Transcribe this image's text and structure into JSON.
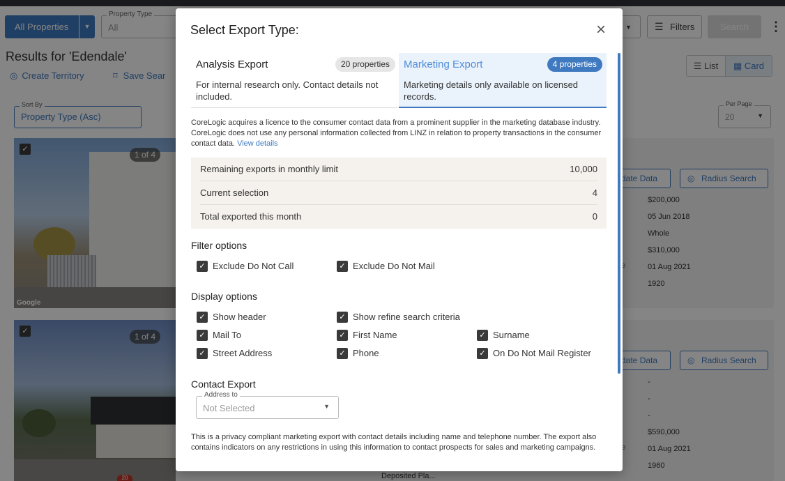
{
  "toolbar": {
    "all_properties": "All Properties",
    "property_type_label": "Property Type",
    "property_type_value": "All",
    "filters": "Filters",
    "search": "Search"
  },
  "results": {
    "title": "Results for 'Edendale'",
    "create_territory": "Create Territory",
    "save_search": "Save Sear",
    "view_list": "List",
    "view_card": "Card",
    "sort_by_label": "Sort By",
    "sort_by_value": "Property Type (Asc)",
    "per_page_label": "Per Page",
    "per_page_value": "20"
  },
  "cards": [
    {
      "counter": "1 of 4",
      "google": "Google",
      "update_label": "date Data",
      "radius_label": "Radius Search",
      "values": [
        "$200,000",
        "05 Jun 2018",
        "Whole",
        "$310,000",
        "01 Aug 2021",
        "1920"
      ],
      "stubs": [
        "e",
        "ate"
      ]
    },
    {
      "counter": "1 of 4",
      "update_label": "date Data",
      "radius_label": "Radius Search",
      "values": [
        "-",
        "-",
        "-",
        "$590,000",
        "01 Aug 2021",
        "1960"
      ],
      "stubs": [
        "e",
        "ate"
      ]
    }
  ],
  "deposited": "Deposited Pla...",
  "badge": "20",
  "modal": {
    "title": "Select Export Type:",
    "tabs": {
      "analysis": {
        "name": "Analysis Export",
        "pill": "20 properties",
        "desc": "For internal research only. Contact details not included."
      },
      "marketing": {
        "name": "Marketing Export",
        "pill": "4 properties",
        "desc": "Marketing details only available on licensed records."
      }
    },
    "licence_text": "CoreLogic acquires a licence to the consumer contact data from a prominent supplier in the marketing database industry. CoreLogic does not use any personal information collected from LINZ in relation to property transactions in the consumer contact data.",
    "view_details": "View details",
    "stats": [
      {
        "label": "Remaining exports in monthly limit",
        "value": "10,000"
      },
      {
        "label": "Current selection",
        "value": "4"
      },
      {
        "label": "Total exported this month",
        "value": "0"
      }
    ],
    "filter_heading": "Filter options",
    "filter_options": [
      "Exclude Do Not Call",
      "Exclude Do Not Mail"
    ],
    "display_heading": "Display options",
    "display_options": [
      "Show header",
      "Show refine search criteria",
      "Mail To",
      "First Name",
      "Surname",
      "Street Address",
      "Phone",
      "On Do Not Mail Register"
    ],
    "contact_heading": "Contact Export",
    "address_to_label": "Address to",
    "address_to_value": "Not Selected",
    "privacy_text": "This is a privacy compliant marketing export with contact details including name and telephone number. The export also contains indicators on any restrictions in using this information to contact prospects for sales and marketing campaigns."
  },
  "colors": {
    "accent": "#3f7ac0",
    "accent_light": "#4f8dd8",
    "tab_active_bg": "#eaf2fb",
    "stats_bg": "#f5f2ee"
  },
  "icons": {
    "close": "close-icon",
    "check": "check-icon",
    "caret": "caret-down-icon",
    "filter": "filter-icon",
    "target": "target-icon",
    "bookmark": "bookmark-icon",
    "list": "list-icon",
    "grid": "grid-icon",
    "more": "more-vertical-icon"
  }
}
